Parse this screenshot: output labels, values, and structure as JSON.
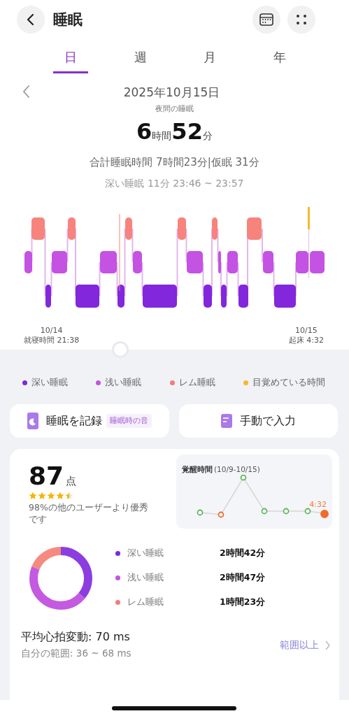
{
  "header": {
    "title": "睡眠"
  },
  "tabs": [
    {
      "label": "日",
      "selected": true
    },
    {
      "label": "週",
      "selected": false
    },
    {
      "label": "月",
      "selected": false
    },
    {
      "label": "年",
      "selected": false
    }
  ],
  "date": "2025年10月15日",
  "summary": {
    "caption": "夜間の睡眠",
    "hours": "6",
    "hours_unit": "時間",
    "minutes": "52",
    "minutes_unit": "分",
    "total": "合計睡眠時間 7時間23分|仮眠 31分",
    "selection": "深い睡眠 11分 23:46 ~ 23:57"
  },
  "hypnogram": {
    "start_date": "10/14",
    "start_label": "就寝時間 21:38",
    "end_date": "10/15",
    "end_label": "起床 4:32"
  },
  "legend": [
    {
      "label": "深い睡眠",
      "color": "#7b2bd9"
    },
    {
      "label": "浅い睡眠",
      "color": "#c254e0"
    },
    {
      "label": "レム睡眠",
      "color": "#f37d78"
    },
    {
      "label": "目覚めている時間",
      "color": "#f5b82e"
    }
  ],
  "actions": [
    {
      "kind": "record",
      "label": "睡眠を記録",
      "tag": "睡眠時の音"
    },
    {
      "kind": "manual",
      "label": "手動で入力"
    }
  ],
  "score": {
    "value": "87",
    "unit": "点",
    "stars": 4.5,
    "comparison": "98%の他のユーザーより優秀です"
  },
  "wake_chart": {
    "title": "覚醒時間",
    "range": "(10/9-10/15)",
    "last_label": "4:32"
  },
  "breakdown": [
    {
      "label": "深い睡眠",
      "value": "2時間42分",
      "color": "#7b2bd9"
    },
    {
      "label": "浅い睡眠",
      "value": "2時間47分",
      "color": "#c254e0"
    },
    {
      "label": "レム睡眠",
      "value": "1時間23分",
      "color": "#f37d78"
    }
  ],
  "hrv": {
    "title": "平均心拍変動: 70 ms",
    "range": "自分の範囲: 36 ~ 68 ms",
    "status": "範囲以上"
  }
}
